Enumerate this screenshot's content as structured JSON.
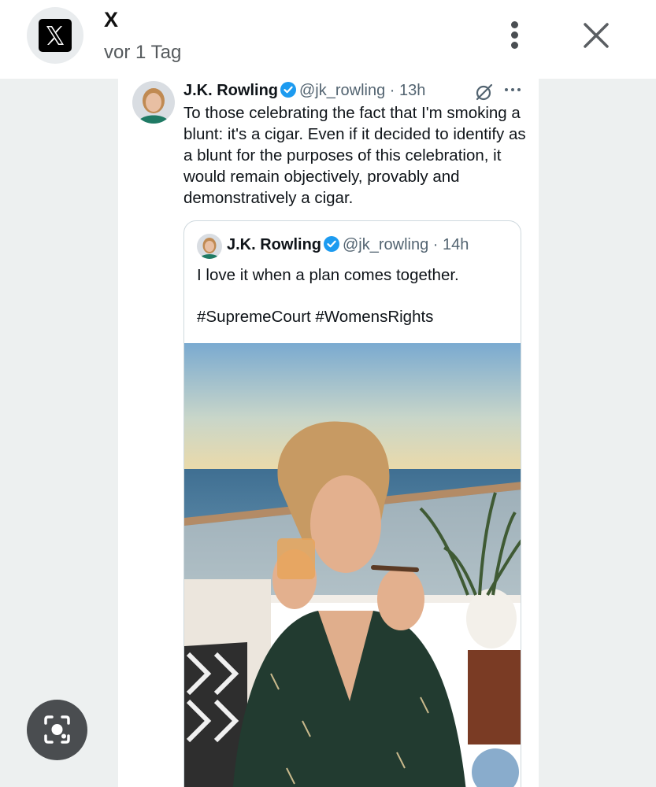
{
  "notification": {
    "app_name": "X",
    "time_ago": "vor 1 Tag",
    "logo_icon": "x-logo-icon",
    "menu_icon": "more-vertical-icon",
    "close_icon": "close-icon"
  },
  "tweet": {
    "author_name": "J.K. Rowling",
    "handle_time": "@jk_rowling · 13h",
    "text": "To those celebrating the fact that I'm smoking a blunt: it's a cigar. Even if it decided to identify as a blunt for the purposes of this celebration, it would remain objectively, provably and demonstratively a cigar.",
    "verified_color": "#1d9bf0"
  },
  "quoted_tweet": {
    "author_name": "J.K. Rowling",
    "handle_time": "@jk_rowling · 14h",
    "text_line1": "I love it when a plan comes together.",
    "text_line2": "#SupremeCourt #WomensRights"
  },
  "lens": {
    "icon": "lens-search-icon"
  }
}
